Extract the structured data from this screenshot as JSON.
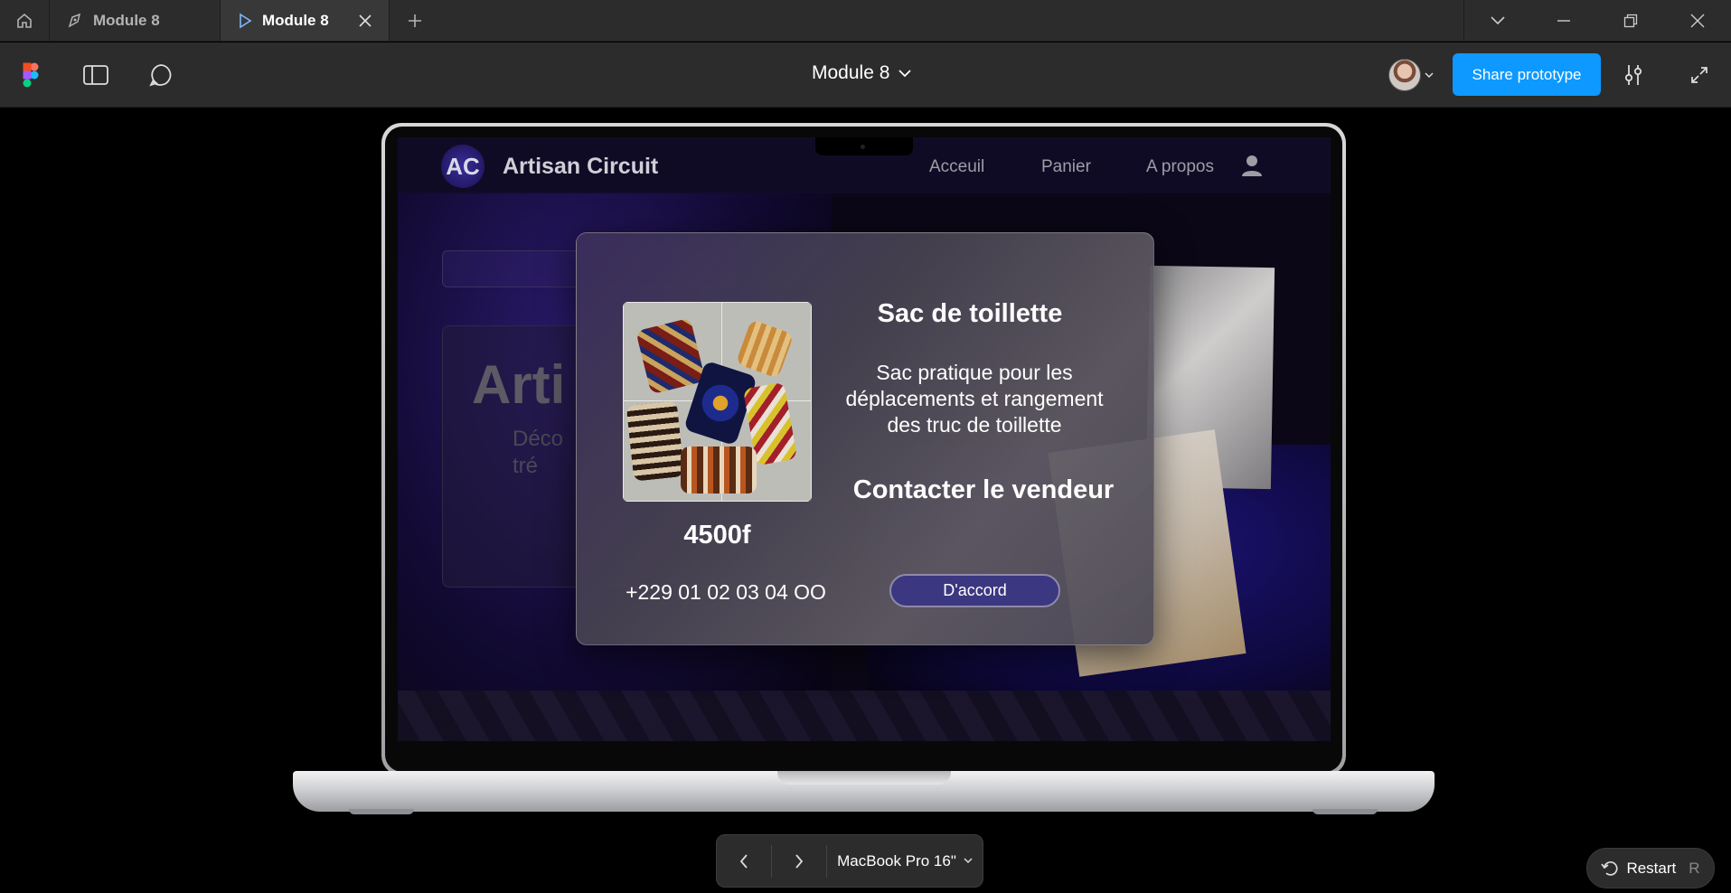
{
  "window": {
    "tabs": [
      {
        "label": "Module 8",
        "active": false
      },
      {
        "label": "Module 8",
        "active": true
      }
    ]
  },
  "toolbar": {
    "doc_title": "Module 8",
    "share_label": "Share prototype"
  },
  "site": {
    "logo_mark": "AC",
    "logo_text": "Artisan Circuit",
    "nav": [
      "Acceuil",
      "Panier",
      "A propos"
    ],
    "hero_title": "Arti",
    "hero_desc": "Déco\ntré"
  },
  "modal": {
    "product_title": "Sac de toillette",
    "description": "Sac pratique pour les déplacements et rangement des truc de toillette",
    "contact_heading": "Contacter le vendeur",
    "price": "4500f",
    "phone": "+229 01 02 03 04 OO",
    "confirm_label": "D'accord"
  },
  "device_bar": {
    "device_label": "MacBook Pro 16\""
  },
  "restart": {
    "label": "Restart",
    "shortcut": "R"
  },
  "colors": {
    "accent": "#0d99ff",
    "modal_button": "#3b3780",
    "chrome": "#2c2c2c"
  }
}
